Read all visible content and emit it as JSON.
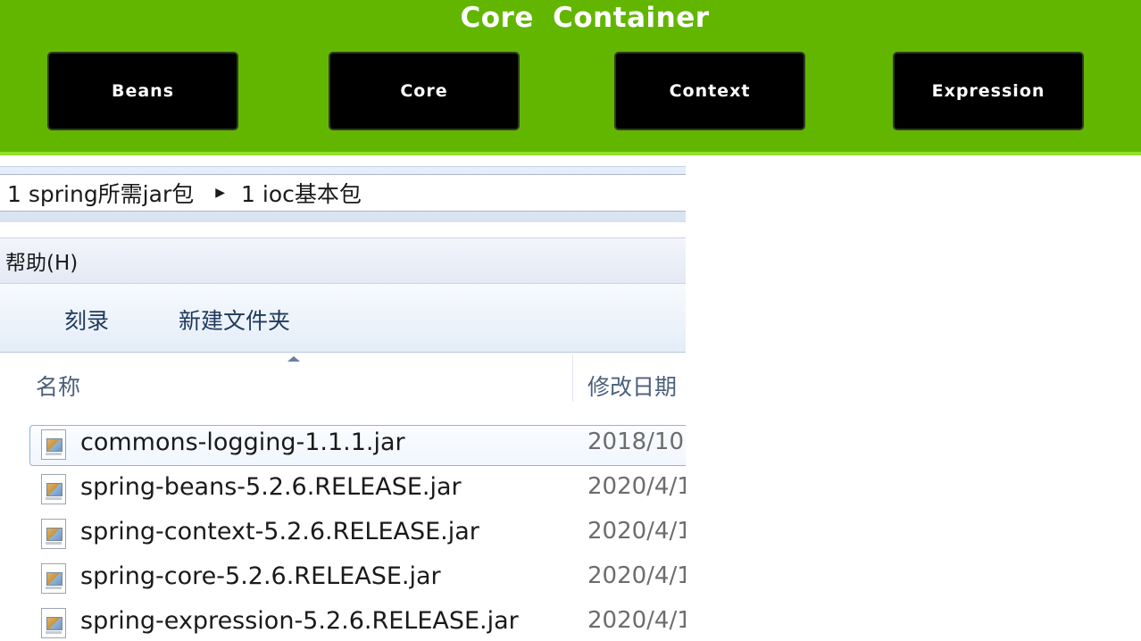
{
  "banner": {
    "title": "Core  Container",
    "modules": [
      "Beans",
      "Core",
      "Context",
      "Expression"
    ]
  },
  "explorer": {
    "breadcrumb": [
      "1 spring所需jar包",
      "1 ioc基本包"
    ],
    "menu": {
      "help": "帮助(H)"
    },
    "toolbar": {
      "burn": "刻录",
      "new_folder": "新建文件夹"
    },
    "columns": {
      "name": "名称",
      "date_modified": "修改日期"
    },
    "files": [
      {
        "name": "commons-logging-1.1.1.jar",
        "date": "2018/10"
      },
      {
        "name": "spring-beans-5.2.6.RELEASE.jar",
        "date": "2020/4/1"
      },
      {
        "name": "spring-context-5.2.6.RELEASE.jar",
        "date": "2020/4/1"
      },
      {
        "name": "spring-core-5.2.6.RELEASE.jar",
        "date": "2020/4/1"
      },
      {
        "name": "spring-expression-5.2.6.RELEASE.jar",
        "date": "2020/4/1"
      }
    ],
    "selected_index": 0
  },
  "colors": {
    "banner_green": "#62b600",
    "module_black": "#000000",
    "selection_border": "#8fb2e0"
  }
}
